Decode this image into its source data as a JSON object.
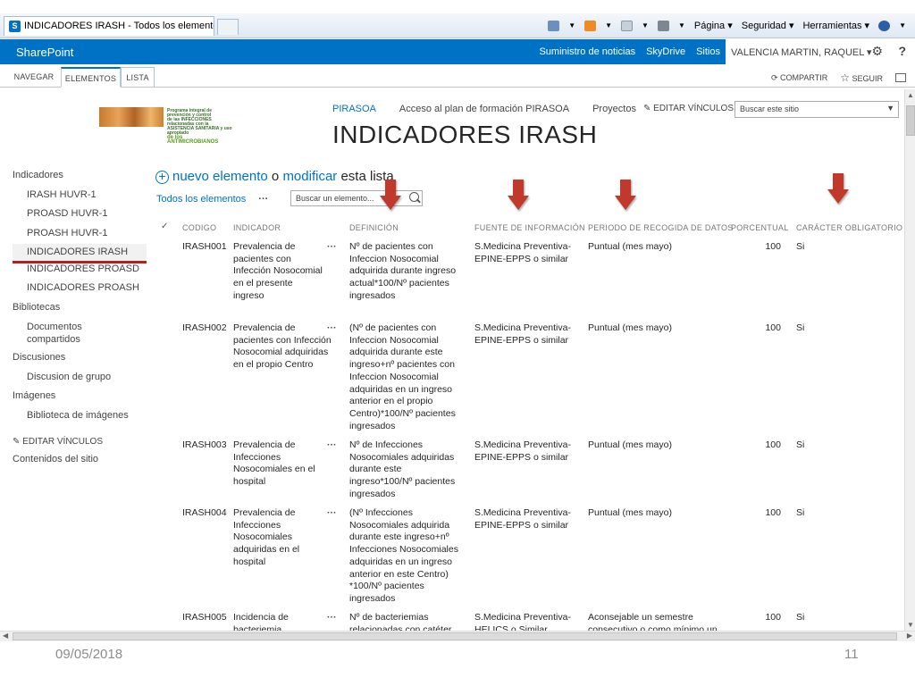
{
  "browser": {
    "tab_title": "INDICADORES IRASH - Todos los elementos",
    "tab_icon": "S",
    "commands": [
      "Página",
      "Seguridad",
      "Herramientas"
    ]
  },
  "suite": {
    "brand": "SharePoint",
    "links": [
      "Suministro de noticias",
      "SkyDrive",
      "Sitios"
    ],
    "user": "VALENCIA MARTIN, RAQUEL",
    "accent": "#0072c6"
  },
  "ribbon": {
    "tabs": [
      "NAVEGAR",
      "ELEMENTOS",
      "LISTA"
    ],
    "share": "COMPARTIR",
    "follow": "SEGUIR"
  },
  "topnav": {
    "items": [
      "PIRASOA",
      "Acceso al plan de formación PIRASOA",
      "Proyectos"
    ],
    "edit": "EDITAR VÍNCULOS",
    "search_placeholder": "Buscar este sitio"
  },
  "logo": {
    "line1": "Programa integral de prevención y control",
    "line2": "de las INFECCIONES relacionadas con la",
    "line3": "ASISTENCIA SANITARIA y uso apropiado",
    "line4": "de los ANTIMICROBIANOS"
  },
  "page": {
    "title": "INDICADORES IRASH"
  },
  "leftnav": {
    "h1": "Indicadores",
    "i1": "IRASH HUVR-1",
    "i2": "PROASD HUVR-1",
    "i3": "PROASH HUVR-1",
    "i4": "INDICADORES IRASH",
    "i5": "INDICADORES PROASD",
    "i6": "INDICADORES PROASH",
    "h2": "Bibliotecas",
    "i7": "Documentos compartidos",
    "h3": "Discusiones",
    "i8": "Discusion de grupo",
    "h4": "Imágenes",
    "i9": "Biblioteca de imágenes",
    "edit": "EDITAR VÍNCULOS",
    "contents": "Contenidos del sitio"
  },
  "list": {
    "new_item": "nuevo elemento",
    "or": "o",
    "modify": "modificar",
    "this_list": "esta lista",
    "view": "Todos los elementos",
    "search_placeholder": "Buscar un elemento...",
    "columns": {
      "check": "✓",
      "codigo": "CODIGO",
      "indicador": "INDICADOR",
      "definicion": "DEFINICIÓN",
      "fuente": "FUENTE DE INFORMACIÓN",
      "periodo": "PERIODO DE RECOGIDA DE DATOS",
      "porcentual": "PORCENTUAL",
      "caracter": "CARÁCTER OBLIGATORIO"
    },
    "rows": [
      {
        "codigo": "IRASH001",
        "indicador": "Prevalencia de pacientes con Infección Nosocomial en el presente ingreso",
        "definicion": "Nº de pacientes con Infeccion Nosocomial adquirida durante ingreso actual*100/Nº pacientes ingresados",
        "fuente": "S.Medicina Preventiva-EPINE-EPPS o similar",
        "periodo": "Puntual (mes mayo)",
        "porcentual": "100",
        "caracter": "Si"
      },
      {
        "codigo": "IRASH002",
        "indicador": "Prevalencia de pacientes con Infección Nosocomial adquiridas en el propio Centro",
        "definicion": "(Nº de pacientes con Infeccion Nosocomial adquirida durante este ingreso+nº pacientes con Infeccion Nosocomial adquiridas en un ingreso anterior en el propio Centro)*100/Nº pacientes ingresados",
        "fuente": "S.Medicina Preventiva-EPINE-EPPS o similar",
        "periodo": "Puntual (mes mayo)",
        "porcentual": "100",
        "caracter": "Si"
      },
      {
        "codigo": "IRASH003",
        "indicador": "Prevalencia de Infecciones Nosocomiales en el hospital",
        "definicion": "Nº de Infecciones Nosocomiales adquiridas durante este ingreso*100/Nº pacientes ingresados",
        "fuente": "S.Medicina Preventiva-EPINE-EPPS o similar",
        "periodo": "Puntual (mes mayo)",
        "porcentual": "100",
        "caracter": "Si"
      },
      {
        "codigo": "IRASH004",
        "indicador": "Prevalencia de Infecciones Nosocomiales adquiridas en el hospital",
        "definicion": "(Nº Infecciones Nosocomiales adquirida durante este ingreso+nº Infecciones Nosocomiales adquiridas en un ingreso anterior en este Centro) *100/Nº pacientes ingresados",
        "fuente": "S.Medicina Preventiva-EPINE-EPPS o similar",
        "periodo": "Puntual (mes mayo)",
        "porcentual": "100",
        "caracter": "Si"
      },
      {
        "codigo": "IRASH005",
        "indicador": "Incidencia de bacteriemia",
        "definicion": "Nº de bacteriemias relacionadas con catéter",
        "fuente": "S.Medicina Preventiva-HELICS o Similar",
        "periodo": "Aconsejable un semestre consecutivo o como mínimo un",
        "porcentual": "100",
        "caracter": "Si"
      }
    ]
  },
  "footer": {
    "date": "09/05/2018",
    "page": "11"
  },
  "colors": {
    "arrow": "#c0392b",
    "selected_underline": "#b22222"
  }
}
